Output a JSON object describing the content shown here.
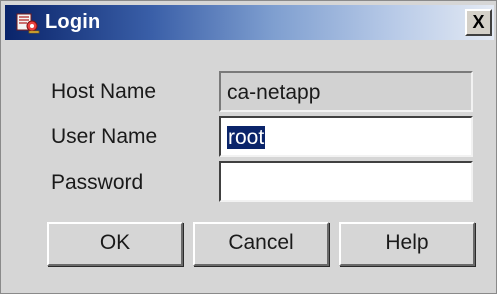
{
  "window": {
    "title": "Login",
    "close_label": "X",
    "title_icon": "login-keys-icon"
  },
  "form": {
    "host_name_label": "Host Name",
    "host_name_value": "ca-netapp",
    "user_name_label": "User Name",
    "user_name_value": "root",
    "password_label": "Password",
    "password_value": ""
  },
  "buttons": {
    "ok": "OK",
    "cancel": "Cancel",
    "help": "Help"
  },
  "colors": {
    "titlebar_start": "#0a246a",
    "titlebar_end": "#e4eaf4",
    "selection": "#0a246a",
    "dialog_bg": "#d6d6d6"
  }
}
